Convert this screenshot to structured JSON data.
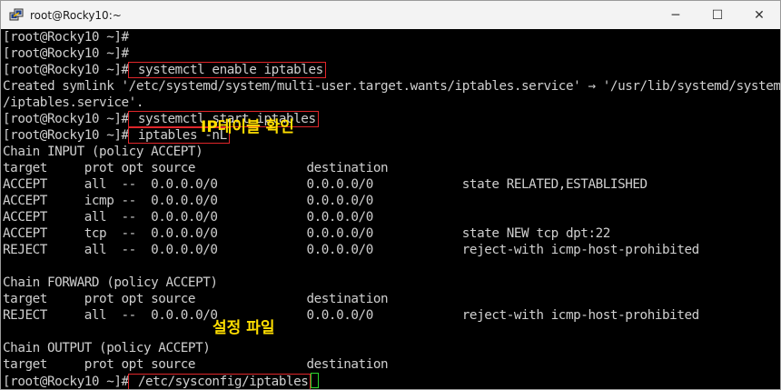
{
  "window": {
    "title": "root@Rocky10:~",
    "controls": {
      "minimize": "─",
      "maximize": "☐",
      "close": "✕"
    }
  },
  "terminal": {
    "lines": [
      {
        "prompt": "[root@Rocky10 ~]#",
        "cmd": ""
      },
      {
        "prompt": "[root@Rocky10 ~]#",
        "cmd": ""
      },
      {
        "prompt": "[root@Rocky10 ~]#",
        "cmd": " systemctl enable iptables",
        "highlight": true
      },
      {
        "text": "Created symlink '/etc/systemd/system/multi-user.target.wants/iptables.service' → '/usr/lib/systemd/system"
      },
      {
        "text": "/iptables.service'."
      },
      {
        "prompt": "[root@Rocky10 ~]#",
        "cmd": " systemctl start iptables",
        "highlight": true
      },
      {
        "prompt": "[root@Rocky10 ~]#",
        "cmd": " iptables -nL",
        "highlight": true
      },
      {
        "text": "Chain INPUT (policy ACCEPT)"
      },
      {
        "text": "target     prot opt source               destination"
      },
      {
        "text": "ACCEPT     all  --  0.0.0.0/0            0.0.0.0/0            state RELATED,ESTABLISHED"
      },
      {
        "text": "ACCEPT     icmp --  0.0.0.0/0            0.0.0.0/0"
      },
      {
        "text": "ACCEPT     all  --  0.0.0.0/0            0.0.0.0/0"
      },
      {
        "text": "ACCEPT     tcp  --  0.0.0.0/0            0.0.0.0/0            state NEW tcp dpt:22"
      },
      {
        "text": "REJECT     all  --  0.0.0.0/0            0.0.0.0/0            reject-with icmp-host-prohibited"
      },
      {
        "text": ""
      },
      {
        "text": "Chain FORWARD (policy ACCEPT)"
      },
      {
        "text": "target     prot opt source               destination"
      },
      {
        "text": "REJECT     all  --  0.0.0.0/0            0.0.0.0/0            reject-with icmp-host-prohibited"
      },
      {
        "text": ""
      },
      {
        "text": "Chain OUTPUT (policy ACCEPT)"
      },
      {
        "text": "target     prot opt source               destination"
      },
      {
        "prompt": "[root@Rocky10 ~]#",
        "cmd": " /etc/sysconfig/iptables",
        "highlight": true,
        "cursor": true
      }
    ]
  },
  "annotations": {
    "iptables_check": "IP테이블 확인",
    "config_file": "설정 파일"
  },
  "colors": {
    "terminal_bg": "#000000",
    "terminal_fg": "#cfcfcf",
    "highlight_box": "#e0262a",
    "annotation": "#ffde00",
    "cursor": "#2bd52b"
  }
}
